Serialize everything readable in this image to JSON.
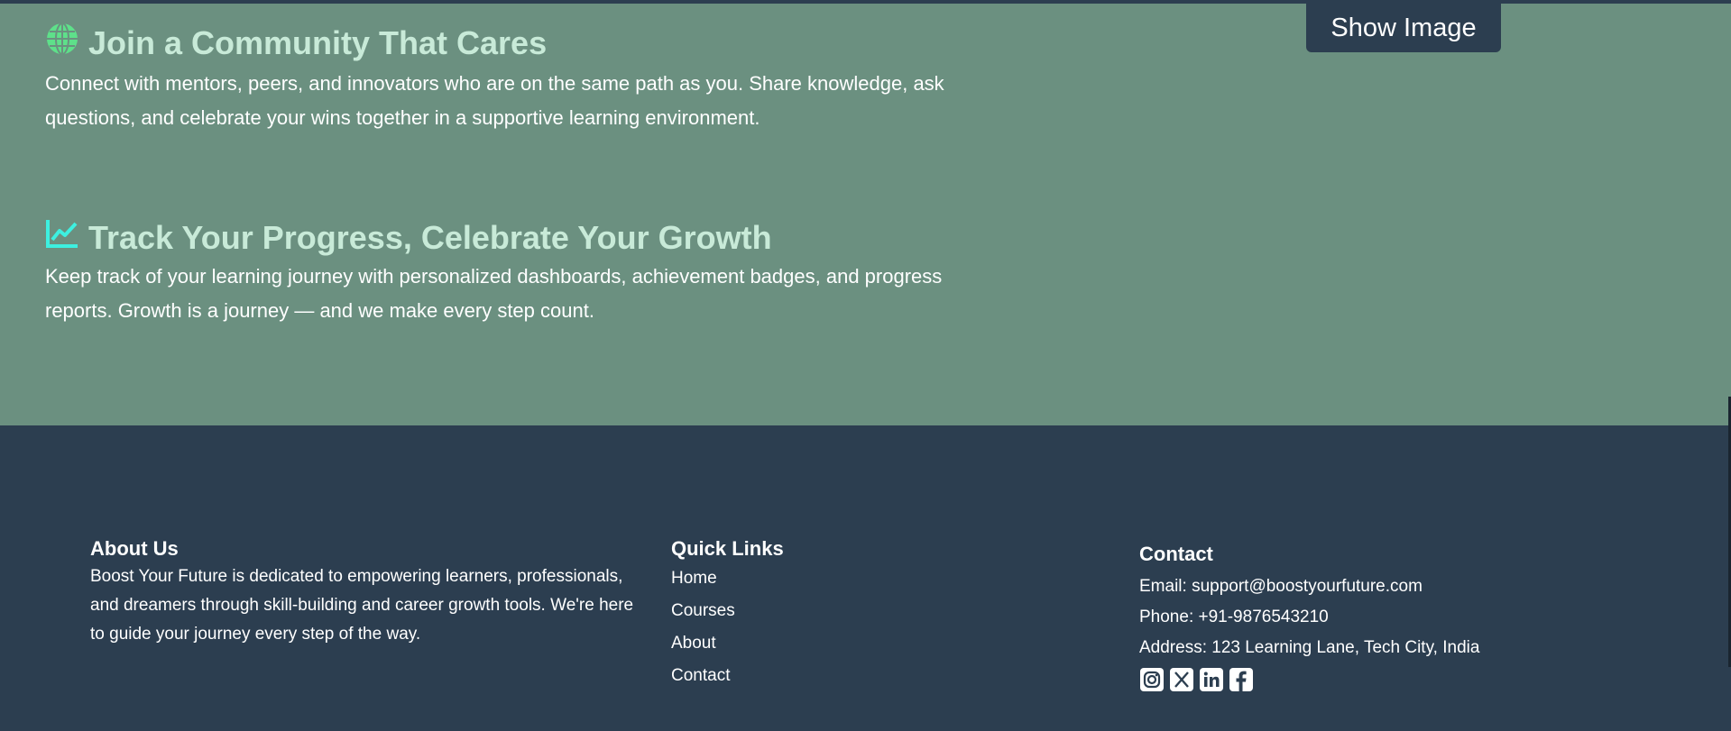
{
  "features": {
    "community": {
      "icon": "globe-icon",
      "title": "Join a Community That Cares",
      "text": "Connect with mentors, peers, and innovators who are on the same path as you. Share knowledge, ask questions, and celebrate your wins together in a supportive learning environment."
    },
    "progress": {
      "icon": "chart-line-icon",
      "title": "Track Your Progress, Celebrate Your Growth",
      "text": "Keep track of your learning journey with personalized dashboards, achievement badges, and progress reports. Growth is a journey — and we make every step count."
    },
    "show_image_label": "Show Image"
  },
  "footer": {
    "about": {
      "heading": "About Us",
      "text": "Boost Your Future is dedicated to empowering learners, professionals, and dreamers through skill-building and career growth tools. We're here to guide your journey every step of the way."
    },
    "quick_links": {
      "heading": "Quick Links",
      "items": [
        "Home",
        "Courses",
        "About",
        "Contact"
      ]
    },
    "contact": {
      "heading": "Contact",
      "email": "Email: support@boostyourfuture.com",
      "phone": "Phone: +91-9876543210",
      "address": "Address: 123 Learning Lane, Tech City, India",
      "socials": [
        "instagram-icon",
        "x-icon",
        "linkedin-icon",
        "facebook-icon"
      ]
    }
  },
  "colors": {
    "features_bg": "#6b9080",
    "footer_bg": "#2c3e50",
    "heading": "#c8ead8",
    "globe": "#5ee08a",
    "chart": "#3df0e0"
  }
}
